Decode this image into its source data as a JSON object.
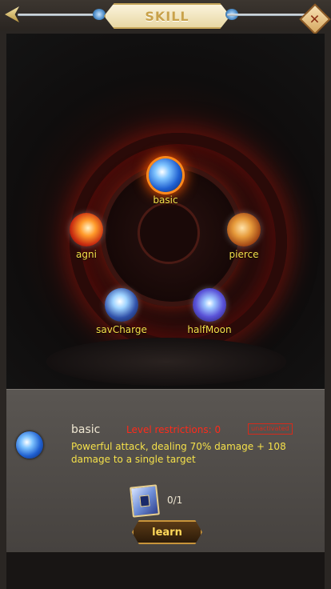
{
  "header": {
    "title": "SKILL",
    "close_icon": "close-icon"
  },
  "skills": [
    {
      "label": "basic",
      "icon": "blue-slash-icon",
      "selected": true
    },
    {
      "label": "agni",
      "icon": "fire-slash-icon"
    },
    {
      "label": "pierce",
      "icon": "amber-pierce-icon"
    },
    {
      "label": "savCharge",
      "icon": "frost-charge-icon"
    },
    {
      "label": "halfMoon",
      "icon": "violet-halfmoon-icon"
    }
  ],
  "info": {
    "name": "basic",
    "level_restriction": "Level restrictions: 0",
    "status": "unactivated",
    "description": "Powerful attack, dealing 70% damage + 108 damage to a single target",
    "book_count": "0/1",
    "learn_label": "learn"
  },
  "colors": {
    "skill_label": "#f4e04a",
    "level_text": "#ff2a1a",
    "title_text": "#c9a24a"
  }
}
